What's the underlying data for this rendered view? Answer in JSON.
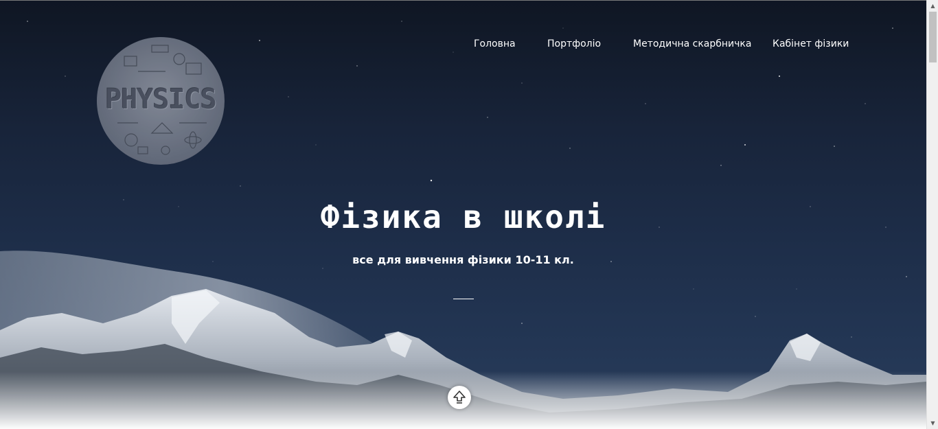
{
  "nav": {
    "items": [
      {
        "label": "Головна"
      },
      {
        "label": "Портфоліо"
      },
      {
        "label": "Методична скарбничка"
      },
      {
        "label": "Кабінет фізики"
      }
    ]
  },
  "logo": {
    "text": "PHYSICS",
    "icon": "physics-logo"
  },
  "hero": {
    "title": "Фізика в школі",
    "subtitle": "все для вивчення фізики 10-11 кл.",
    "scroll_icon": "arrow-up-icon"
  },
  "colors": {
    "sky_top": "#0f1623",
    "sky_bottom": "#2a3e5c",
    "text": "#ffffff"
  }
}
